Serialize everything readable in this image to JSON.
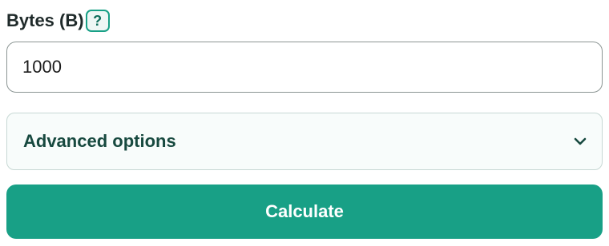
{
  "field": {
    "label": "Bytes (B)",
    "help_glyph": "?",
    "help_icon": "question-mark-icon",
    "value": "1000"
  },
  "advanced": {
    "label": "Advanced options",
    "icon": "chevron-down-icon",
    "expanded": false
  },
  "action": {
    "calculate_label": "Calculate"
  },
  "colors": {
    "accent": "#18a086",
    "heading_dark_green": "#17493f",
    "input_border": "#8b9593",
    "panel_border": "#c7d8d4"
  }
}
